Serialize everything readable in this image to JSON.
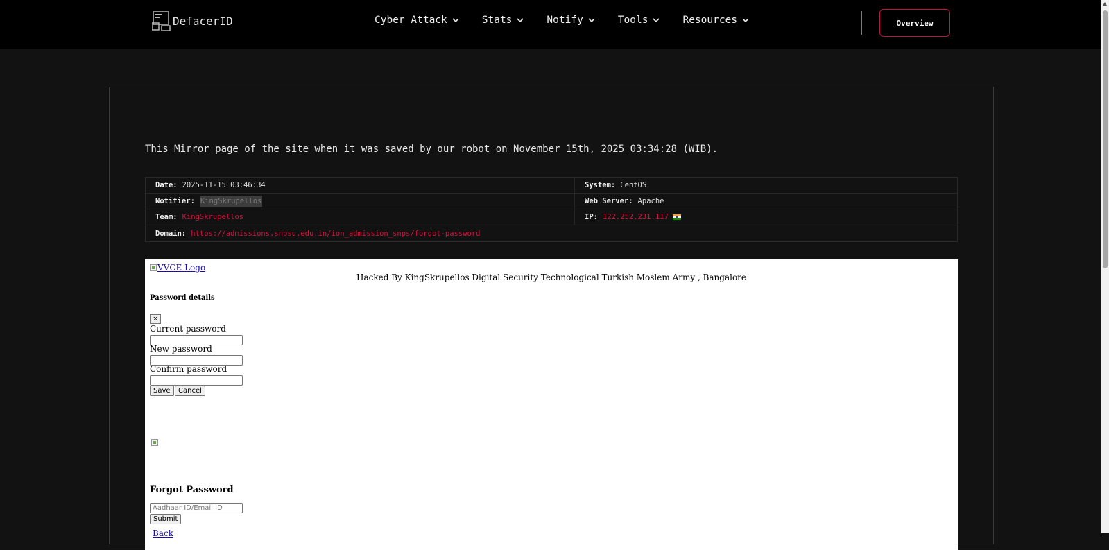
{
  "header": {
    "logo_text": "DefacerID",
    "nav": [
      {
        "label": "Cyber Attack"
      },
      {
        "label": "Stats"
      },
      {
        "label": "Notify"
      },
      {
        "label": "Tools"
      },
      {
        "label": "Resources"
      }
    ],
    "overview_label": "Overview"
  },
  "mirror_notice": "This Mirror page of the site when it was saved by our robot on November 15th, 2025 03:34:28 (WIB).",
  "info": {
    "date_label": "Date:",
    "date_value": "2025-11-15 03:46:34",
    "system_label": "System:",
    "system_value": "CentOS",
    "notifier_label": "Notifier:",
    "notifier_value": "KingSkrupellos",
    "webserver_label": "Web Server:",
    "webserver_value": "Apache",
    "team_label": "Team:",
    "team_value": "KingSkrupellos",
    "ip_label": "IP:",
    "ip_value": "122.252.231.117",
    "domain_label": "Domain:",
    "domain_value": "https://admissions.snpsu.edu.in/ion_admission_snps/forgot-password"
  },
  "mirror_page": {
    "logo_alt": "VVCE Logo",
    "hacked_text": "Hacked By KingSkrupellos Digital Security Technological Turkish Moslem Army , Bangalore",
    "password_details": "Password details",
    "close_label": "×",
    "current_password_label": "Current password",
    "new_password_label": "New password",
    "confirm_password_label": "Confirm password",
    "save_label": "Save",
    "cancel_label": "Cancel",
    "forgot_title": "Forgot Password",
    "aadhaar_placeholder": "Aadhaar ID/Email ID",
    "submit_label": "Submit",
    "back_label": "Back"
  },
  "colors": {
    "accent_red": "#d1153e",
    "background": "#121212",
    "header_bg": "#000000"
  }
}
